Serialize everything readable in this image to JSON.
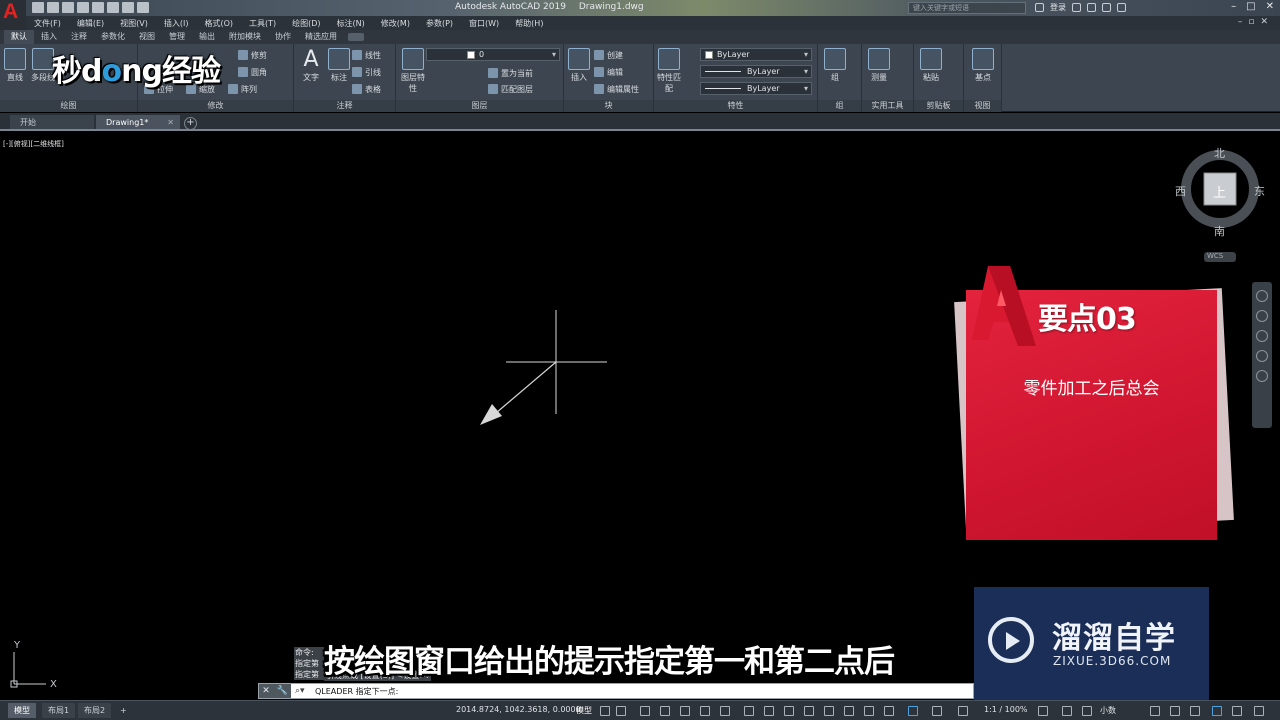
{
  "titlebar": {
    "app_title": "Autodesk AutoCAD 2019",
    "doc_title": "Drawing1.dwg",
    "search_placeholder": "键入关键字或短语",
    "login_label": "登录"
  },
  "menu": [
    "文件(F)",
    "编辑(E)",
    "视图(V)",
    "插入(I)",
    "格式(O)",
    "工具(T)",
    "绘图(D)",
    "标注(N)",
    "修改(M)",
    "参数(P)",
    "窗口(W)",
    "帮助(H)"
  ],
  "ribbon_tabs": [
    "默认",
    "插入",
    "注释",
    "参数化",
    "视图",
    "管理",
    "输出",
    "附加模块",
    "协作",
    "精选应用"
  ],
  "ribbon": {
    "draw": {
      "title": "绘图",
      "line": "直线",
      "polyline": "多段线"
    },
    "modify": {
      "title": "修改",
      "move": "修剪",
      "fillet": "圆角",
      "stretch": "拉伸",
      "scale": "缩放",
      "array": "阵列"
    },
    "annotation": {
      "title": "注释",
      "text": "文字",
      "dimension": "标注",
      "linear": "线性",
      "leader": "引线",
      "table": "表格"
    },
    "layers": {
      "title": "图层",
      "layer_props": "图层特性",
      "layer_value": "0",
      "set_current": "置为当前",
      "match_layer": "匹配图层"
    },
    "block": {
      "title": "块",
      "insert": "插入",
      "create": "创建",
      "edit": "编辑",
      "edit_attr": "编辑属性"
    },
    "properties": {
      "title": "特性",
      "match": "特性匹配",
      "color": "ByLayer",
      "linetype": "ByLayer",
      "lineweight": "ByLayer"
    },
    "groups": {
      "title": "组",
      "group": "组"
    },
    "utilities": {
      "title": "实用工具",
      "measure": "测量"
    },
    "clipboard": {
      "title": "剪贴板",
      "paste": "粘贴"
    },
    "view": {
      "title": "视图",
      "base": "基点"
    }
  },
  "brand_logo": {
    "pre": "秒d",
    "o": "o",
    "post": "ng经验"
  },
  "doc_tabs": {
    "start": "开始",
    "drawing": "Drawing1*"
  },
  "viewport_label": "[-][俯视][二维线框]",
  "viewcube": {
    "north": "北",
    "south": "南",
    "east": "东",
    "west": "西",
    "face": "上",
    "wcs": "WCS"
  },
  "card": {
    "title": "要点03",
    "subtitle": "零件加工之后总会"
  },
  "zixue": {
    "cn": "溜溜自学",
    "en": "ZIXUE.3D66.COM"
  },
  "command": {
    "history": [
      "命令:",
      "指定第",
      "指定第"
    ],
    "history_tail": "引线点或 [设置(S)] <设置>:",
    "prompt": "QLEADER 指定下一点:"
  },
  "subtitle": "按绘图窗口给出的提示指定第一和第二点后",
  "ucs": {
    "x": "X",
    "y": "Y"
  },
  "statusbar": {
    "tabs": [
      "模型",
      "布局1",
      "布局2"
    ],
    "coords": "2014.8724, 1042.3618, 0.0000",
    "model": "模型",
    "scale": "1:1 / 100%",
    "units": "小数"
  }
}
